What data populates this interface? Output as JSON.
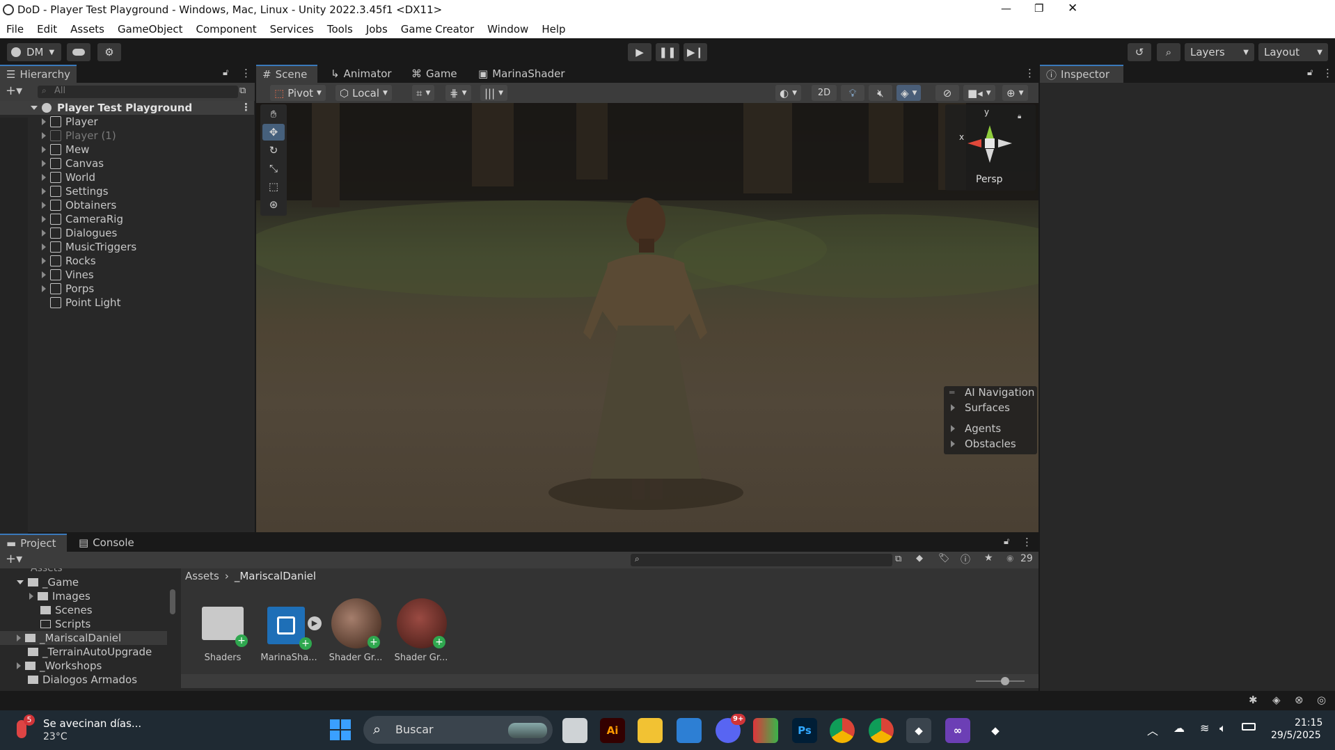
{
  "window": {
    "title": "DoD - Player Test Playground - Windows, Mac, Linux - Unity 2022.3.45f1 <DX11>",
    "minimize": "—",
    "maximize": "❐",
    "close": "✕"
  },
  "menu": [
    "File",
    "Edit",
    "Assets",
    "GameObject",
    "Component",
    "Services",
    "Tools",
    "Jobs",
    "Game Creator",
    "Window",
    "Help"
  ],
  "toolbar": {
    "account": "DM",
    "layers": "Layers",
    "layout": "Layout"
  },
  "hierarchy": {
    "tab": "Hierarchy",
    "search_placeholder": "All",
    "scene": "Player Test Playground",
    "items": [
      {
        "label": "Player",
        "disabled": false,
        "expandable": true
      },
      {
        "label": "Player (1)",
        "disabled": true,
        "expandable": true
      },
      {
        "label": "Mew",
        "disabled": false,
        "expandable": true
      },
      {
        "label": "Canvas",
        "disabled": false,
        "expandable": true
      },
      {
        "label": "World",
        "disabled": false,
        "expandable": true
      },
      {
        "label": "Settings",
        "disabled": false,
        "expandable": true
      },
      {
        "label": "Obtainers",
        "disabled": false,
        "expandable": true
      },
      {
        "label": "CameraRig",
        "disabled": false,
        "expandable": true
      },
      {
        "label": "Dialogues",
        "disabled": false,
        "expandable": true
      },
      {
        "label": "MusicTriggers",
        "disabled": false,
        "expandable": true
      },
      {
        "label": "Rocks",
        "disabled": false,
        "expandable": true
      },
      {
        "label": "Vines",
        "disabled": false,
        "expandable": true
      },
      {
        "label": "Porps",
        "disabled": false,
        "expandable": true
      },
      {
        "label": "Point Light",
        "disabled": false,
        "expandable": false
      }
    ]
  },
  "scene_tabs": [
    "Scene",
    "Animator",
    "Game",
    "MarinaShader"
  ],
  "scene_toolbar": {
    "pivot": "Pivot",
    "local": "Local",
    "mode_2d": "2D"
  },
  "gizmo": {
    "y": "y",
    "x": "x",
    "persp": "Persp"
  },
  "ai_navigation": {
    "title": "AI Navigation",
    "items": [
      "Surfaces",
      "Agents",
      "Obstacles"
    ]
  },
  "inspector": {
    "tab": "Inspector"
  },
  "project": {
    "tabs": [
      "Project",
      "Console"
    ],
    "tree_header": "Assets",
    "tree": [
      {
        "label": "_Game",
        "depth": 1,
        "expanded": true
      },
      {
        "label": "Images",
        "depth": 2,
        "expanded": false
      },
      {
        "label": "Scenes",
        "depth": 2,
        "expanded": false
      },
      {
        "label": "Scripts",
        "depth": 2,
        "expanded": false
      },
      {
        "label": "_MariscalDaniel",
        "depth": 1,
        "expanded": false,
        "selected": true
      },
      {
        "label": "_TerrainAutoUpgrade",
        "depth": 1,
        "expanded": false
      },
      {
        "label": "_Workshops",
        "depth": 1,
        "expanded": false
      },
      {
        "label": "Dialogos Armados",
        "depth": 1,
        "expanded": false
      }
    ],
    "breadcrumb": [
      "Assets",
      "_MariscalDaniel"
    ],
    "hidden_count": "29",
    "assets": [
      {
        "label": "Shaders",
        "kind": "folder"
      },
      {
        "label": "MarinaSha...",
        "kind": "shader"
      },
      {
        "label": "Shader Gr...",
        "kind": "material1"
      },
      {
        "label": "Shader Gr...",
        "kind": "material2"
      }
    ]
  },
  "taskbar": {
    "weather_title": "Se avecinan días...",
    "weather_temp": "23°C",
    "weather_badge": "5",
    "search": "Buscar",
    "discord_badge": "9+",
    "time": "21:15",
    "date": "29/5/2025"
  },
  "colors": {
    "accent": "#3a79bb",
    "dark_bg": "#191919",
    "panel_bg": "#282828",
    "toolbar_bg": "#3c3c3c"
  }
}
